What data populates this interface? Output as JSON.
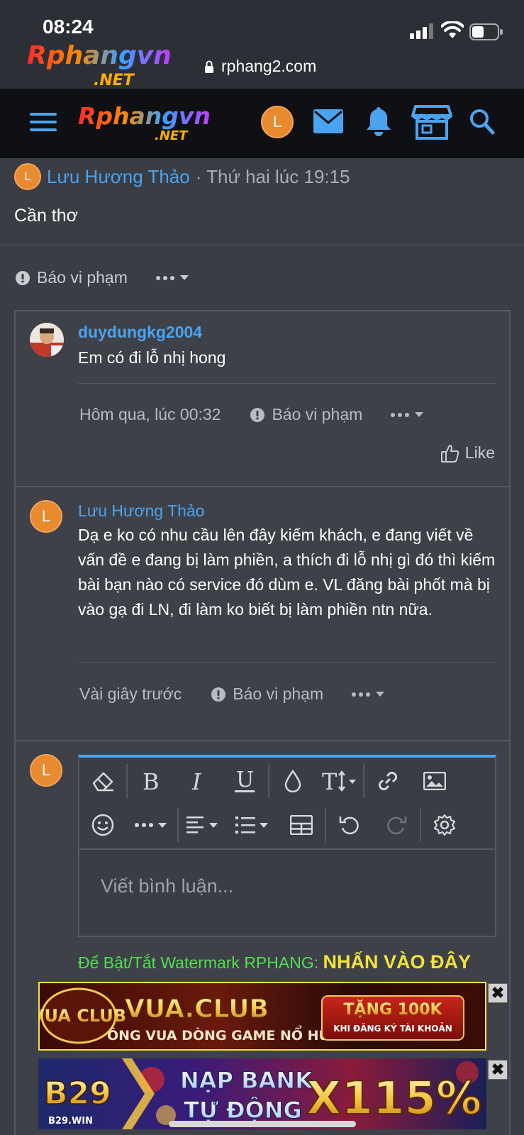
{
  "status": {
    "time": "08:24"
  },
  "browser": {
    "url": "rphang2.com"
  },
  "brand": {
    "logo_main": "Rphangvn",
    "logo_sub": ".NET"
  },
  "nav": {
    "avatar_letter": "L"
  },
  "post": {
    "author_initial": "L",
    "author": "Lưu Hương Thảo",
    "date": "· Thứ hai lúc 19:15",
    "body": "Cần thơ",
    "report_label": "Báo vi phạm"
  },
  "comments": [
    {
      "author": "duydungkg2004",
      "text": "Em có đi lỗ nhị hong",
      "time": "Hôm qua, lúc 00:32",
      "report_label": "Báo vi phạm",
      "like_label": "Like"
    },
    {
      "author_initial": "L",
      "author": "Lưu Hương Thảo",
      "text": "Dạ e ko có nhu cầu lên đây kiếm khách, e đang viết về vấn đề e đang bị làm phiền, a thích đi lỗ nhị gì đó thì kiếm bài bạn nào có service đó dùm e. VL đăng bài phốt mà bị vào gạ đi LN, đi làm ko biết bị làm phiền ntn nữa.",
      "time": "Vài giây trước",
      "report_label": "Báo vi phạm"
    }
  ],
  "editor": {
    "avatar_letter": "L",
    "placeholder": "Viết bình luận..."
  },
  "watermark": {
    "text": "Để Bật/Tắt Watermark RPHANG:",
    "link": "NHẤN VÀO ĐÂY"
  },
  "ads": {
    "ad1": {
      "brand": "VUA.CLUB",
      "tagline": "ÔNG VUA DÒNG GAME NỔ HŨ",
      "promo_top": "TẶNG 100K",
      "promo_bottom": "KHI ĐĂNG KÝ TÀI KHOẢN",
      "logo": "VUA CLUB"
    },
    "ad2": {
      "logo": "B29",
      "logo_sub": "B29.WIN",
      "line1": "NẠP BANK",
      "line2": "TỰ ĐỘNG",
      "big": "X115%"
    },
    "close_glyph": "✖"
  },
  "colors": {
    "accent": "#4aa3f0",
    "avatar": "#e88a2f",
    "watermark_green": "#4fe04f",
    "watermark_yellow": "#f2e23a"
  }
}
